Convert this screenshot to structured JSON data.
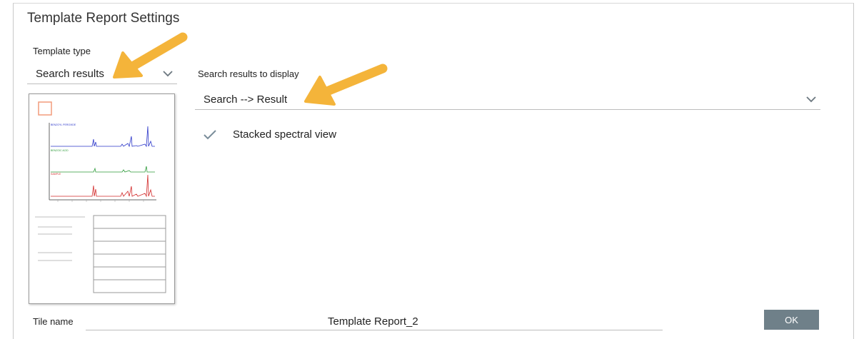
{
  "dialog": {
    "title": "Template Report Settings",
    "template_type_label": "Template type",
    "template_type_value": "Search results",
    "display_label": "Search results to display",
    "display_value": "Search --> Result",
    "stacked_checkbox_label": "Stacked spectral view",
    "stacked_checked": true,
    "tile_name_label": "Tile name",
    "tile_name_value": "Template Report_2",
    "ok_label": "OK"
  },
  "colors": {
    "arrow": "#f4b43a",
    "ok_button": "#6f8089",
    "check": "#7a8d9a",
    "spectrum_blue": "#2b36c9",
    "spectrum_green": "#2e9a3a",
    "spectrum_red": "#d22a2a",
    "logo_box": "#f29c7c"
  },
  "icons": [
    "chevron-down-icon",
    "check-icon",
    "arrow-pointer-icon"
  ]
}
